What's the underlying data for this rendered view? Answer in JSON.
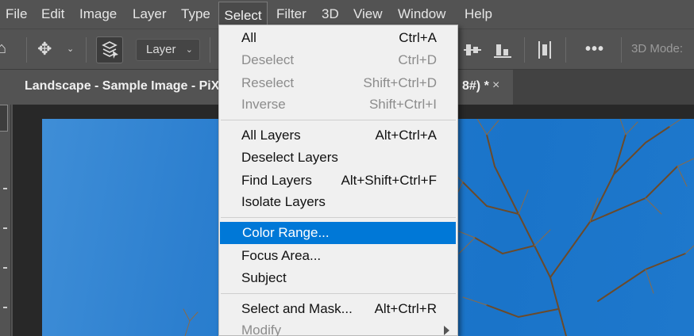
{
  "menubar": {
    "items": [
      {
        "label": "File"
      },
      {
        "label": "Edit"
      },
      {
        "label": "Image"
      },
      {
        "label": "Layer"
      },
      {
        "label": "Type"
      },
      {
        "label": "Select"
      },
      {
        "label": "Filter"
      },
      {
        "label": "3D"
      },
      {
        "label": "View"
      },
      {
        "label": "Window"
      },
      {
        "label": "Help"
      }
    ],
    "active": "Select"
  },
  "options": {
    "layer_select": "Layer",
    "three_d_mode": "3D Mode:"
  },
  "document": {
    "tab_title_left": "Landscape - Sample Image - PiX",
    "tab_title_right": "8#) *",
    "close_glyph": "×"
  },
  "select_menu": {
    "groups": [
      [
        {
          "label": "All",
          "shortcut": "Ctrl+A",
          "enabled": true
        },
        {
          "label": "Deselect",
          "shortcut": "Ctrl+D",
          "enabled": false
        },
        {
          "label": "Reselect",
          "shortcut": "Shift+Ctrl+D",
          "enabled": false
        },
        {
          "label": "Inverse",
          "shortcut": "Shift+Ctrl+I",
          "enabled": false
        }
      ],
      [
        {
          "label": "All Layers",
          "shortcut": "Alt+Ctrl+A",
          "enabled": true
        },
        {
          "label": "Deselect Layers",
          "shortcut": "",
          "enabled": true
        },
        {
          "label": "Find Layers",
          "shortcut": "Alt+Shift+Ctrl+F",
          "enabled": true
        },
        {
          "label": "Isolate Layers",
          "shortcut": "",
          "enabled": true
        }
      ],
      [
        {
          "label": "Color Range...",
          "shortcut": "",
          "enabled": true,
          "highlighted": true
        },
        {
          "label": "Focus Area...",
          "shortcut": "",
          "enabled": true
        },
        {
          "label": "Subject",
          "shortcut": "",
          "enabled": true
        }
      ],
      [
        {
          "label": "Select and Mask...",
          "shortcut": "Alt+Ctrl+R",
          "enabled": true
        },
        {
          "label": "Modify",
          "shortcut": "",
          "enabled": false,
          "submenu": true
        }
      ]
    ]
  },
  "colors": {
    "highlight": "#0078d7",
    "menu_bg": "#f0f0f0",
    "app_bg": "#535353",
    "sky": "#1a74c9"
  },
  "icons": [
    "move-icon",
    "chevron-down-icon",
    "auto-select-layers-icon",
    "align-icon",
    "more-icon",
    "submenu-arrow-icon"
  ]
}
